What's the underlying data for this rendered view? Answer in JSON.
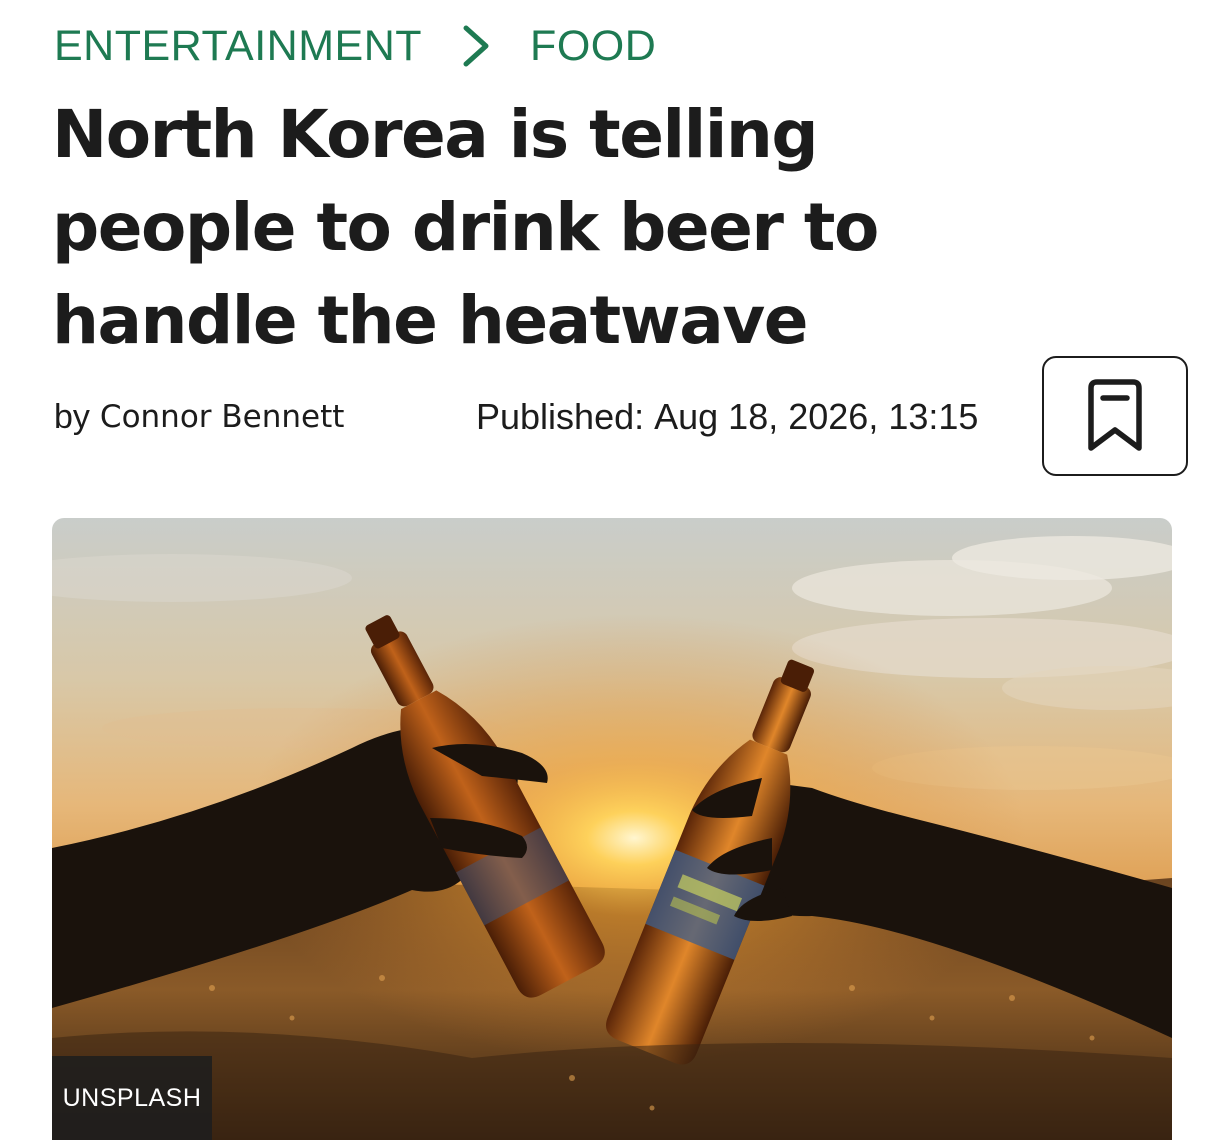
{
  "breadcrumb": {
    "items": [
      "ENTERTAINMENT",
      "FOOD"
    ],
    "separator_icon": "chevron-right-icon",
    "accent_color": "#1e7a52"
  },
  "article": {
    "headline": "North Korea is telling people to drink beer to handle the heatwave",
    "byline_prefix": "by",
    "author": "Connor Bennett",
    "published_label": "Published:",
    "published_date": "Aug 18, 2026, 13:15"
  },
  "actions": {
    "bookmark_icon": "bookmark-icon"
  },
  "hero": {
    "credit": "UNSPLASH"
  }
}
